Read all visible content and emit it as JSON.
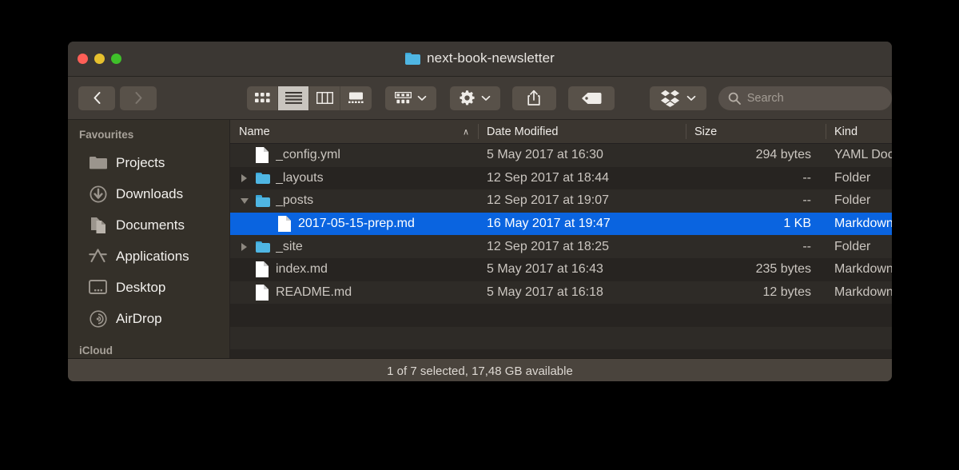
{
  "window": {
    "title": "next-book-newsletter",
    "title_icon": "blue-folder-icon",
    "traffic_lights": {
      "close": "close-button",
      "minimize": "minimize-button",
      "zoom": "zoom-button",
      "close_color": "#ff5f57",
      "minimize_color": "#e6c02e",
      "zoom_color": "#3fc02a"
    }
  },
  "toolbar": {
    "back_label": "‹",
    "forward_label": "›",
    "view_modes": [
      {
        "name": "icon-view",
        "selected": false
      },
      {
        "name": "list-view",
        "selected": true
      },
      {
        "name": "column-view",
        "selected": false
      },
      {
        "name": "gallery-view",
        "selected": false
      }
    ],
    "arrange_label": "arrange-by",
    "action_label": "action-menu",
    "share_label": "share",
    "tags_label": "edit-tags",
    "dropbox_label": "dropbox-menu",
    "search": {
      "placeholder": "Search",
      "value": ""
    }
  },
  "sidebar": {
    "sections": [
      {
        "header": "Favourites",
        "items": [
          {
            "label": "Projects",
            "icon": "folder-icon"
          },
          {
            "label": "Downloads",
            "icon": "download-icon"
          },
          {
            "label": "Documents",
            "icon": "documents-icon"
          },
          {
            "label": "Applications",
            "icon": "applications-icon"
          },
          {
            "label": "Desktop",
            "icon": "desktop-icon"
          },
          {
            "label": "AirDrop",
            "icon": "airdrop-icon"
          }
        ]
      }
    ],
    "next_header": "iCloud"
  },
  "filelist": {
    "columns": [
      {
        "key": "name",
        "label": "Name",
        "sorted": "ascending"
      },
      {
        "key": "date",
        "label": "Date Modified"
      },
      {
        "key": "size",
        "label": "Size"
      },
      {
        "key": "kind",
        "label": "Kind"
      }
    ],
    "sort_indicator": "∧",
    "rows": [
      {
        "name": "_config.yml",
        "date": "5 May 2017 at 16:30",
        "size": "294 bytes",
        "kind": "YAML Docu",
        "icon": "document-icon",
        "disclosure": "none",
        "indent": 0,
        "selected": false
      },
      {
        "name": "_layouts",
        "date": "12 Sep 2017 at 18:44",
        "size": "--",
        "kind": "Folder",
        "icon": "folder-icon",
        "disclosure": "closed",
        "indent": 0,
        "selected": false
      },
      {
        "name": "_posts",
        "date": "12 Sep 2017 at 19:07",
        "size": "--",
        "kind": "Folder",
        "icon": "folder-icon",
        "disclosure": "open",
        "indent": 0,
        "selected": false
      },
      {
        "name": "2017-05-15-prep.md",
        "date": "16 May 2017 at 19:47",
        "size": "1 KB",
        "kind": "Markdown",
        "icon": "document-icon",
        "disclosure": "none",
        "indent": 1,
        "selected": true
      },
      {
        "name": "_site",
        "date": "12 Sep 2017 at 18:25",
        "size": "--",
        "kind": "Folder",
        "icon": "folder-icon",
        "disclosure": "closed",
        "indent": 0,
        "selected": false
      },
      {
        "name": "index.md",
        "date": "5 May 2017 at 16:43",
        "size": "235 bytes",
        "kind": "Markdown",
        "icon": "document-icon",
        "disclosure": "none",
        "indent": 0,
        "selected": false
      },
      {
        "name": "README.md",
        "date": "5 May 2017 at 16:18",
        "size": "12 bytes",
        "kind": "Markdown",
        "icon": "document-icon",
        "disclosure": "none",
        "indent": 0,
        "selected": false
      }
    ],
    "selection_color": "#0a64e0"
  },
  "statusbar": {
    "text": "1 of 7 selected, 17,48 GB available"
  }
}
